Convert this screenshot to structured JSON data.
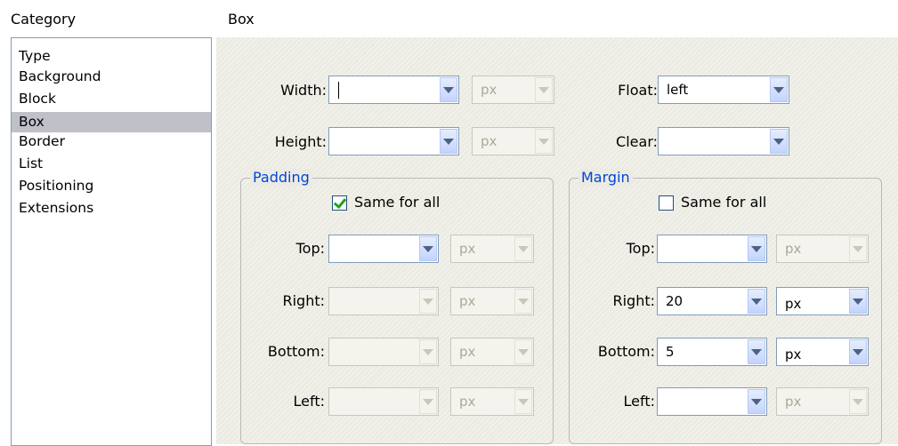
{
  "headers": {
    "category": "Category",
    "panel_title": "Box"
  },
  "categories": [
    "Type",
    "Background",
    "Block",
    "Box",
    "Border",
    "List",
    "Positioning",
    "Extensions"
  ],
  "selected_category": "Box",
  "box": {
    "width": {
      "label": "Width:",
      "value": "",
      "unit": "px"
    },
    "height": {
      "label": "Height:",
      "value": "",
      "unit": "px"
    },
    "float": {
      "label": "Float:",
      "value": "left"
    },
    "clear": {
      "label": "Clear:",
      "value": ""
    }
  },
  "padding": {
    "legend": "Padding",
    "same_for_all_label": "Same for all",
    "same_for_all_checked": true,
    "top": {
      "label": "Top:",
      "value": "",
      "unit": "px"
    },
    "right": {
      "label": "Right:",
      "value": "",
      "unit": "px"
    },
    "bottom": {
      "label": "Bottom:",
      "value": "",
      "unit": "px"
    },
    "left": {
      "label": "Left:",
      "value": "",
      "unit": "px"
    }
  },
  "margin": {
    "legend": "Margin",
    "same_for_all_label": "Same for all",
    "same_for_all_checked": false,
    "top": {
      "label": "Top:",
      "value": "",
      "unit": "px"
    },
    "right": {
      "label": "Right:",
      "value": "20",
      "unit": "px"
    },
    "bottom": {
      "label": "Bottom:",
      "value": "5",
      "unit": "px"
    },
    "left": {
      "label": "Left:",
      "value": "",
      "unit": "px"
    }
  },
  "colors": {
    "accent_legend": "#0046d5",
    "selection": "#c0c0c8",
    "checkmark": "#21a121"
  }
}
